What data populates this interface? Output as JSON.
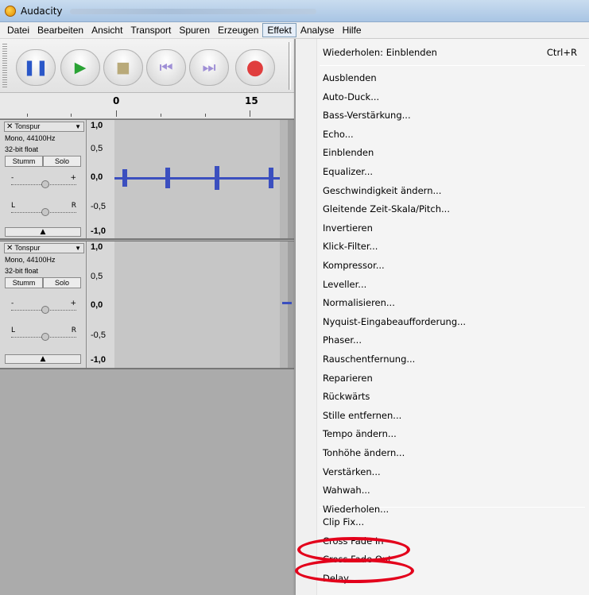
{
  "window": {
    "title": "Audacity"
  },
  "menubar": {
    "items": [
      "Datei",
      "Bearbeiten",
      "Ansicht",
      "Transport",
      "Spuren",
      "Erzeugen",
      "Effekt",
      "Analyse",
      "Hilfe"
    ],
    "active": "Effekt"
  },
  "transport": {
    "buttons": [
      {
        "name": "pause",
        "glyph": "❚❚",
        "color": "#2a57c8"
      },
      {
        "name": "play",
        "glyph": "▶",
        "color": "#2aa335"
      },
      {
        "name": "stop",
        "glyph": "■",
        "color": "#b9aa7a"
      },
      {
        "name": "skip-start",
        "glyph": "⏮",
        "color": "#9f8fd6"
      },
      {
        "name": "skip-end",
        "glyph": "⏭",
        "color": "#9f8fd6"
      },
      {
        "name": "record",
        "glyph": "●",
        "color": "#e03e3e"
      }
    ]
  },
  "ruler": {
    "labels": [
      "0",
      "15"
    ]
  },
  "tracks": [
    {
      "name": "Tonspur",
      "info1": "Mono, 44100Hz",
      "info2": "32-bit float",
      "mute": "Stumm",
      "solo": "Solo",
      "gain_minus": "-",
      "gain_plus": "+",
      "pan_left": "L",
      "pan_right": "R",
      "scale": [
        "1,0",
        "0,5",
        "0,0",
        "-0,5",
        "-1,0"
      ]
    },
    {
      "name": "Tonspur",
      "info1": "Mono, 44100Hz",
      "info2": "32-bit float",
      "mute": "Stumm",
      "solo": "Solo",
      "gain_minus": "-",
      "gain_plus": "+",
      "pan_left": "L",
      "pan_right": "R",
      "scale": [
        "1,0",
        "0,5",
        "0,0",
        "-0,5",
        "-1,0"
      ]
    }
  ],
  "effect_menu": {
    "repeat": {
      "label": "Wiederholen: Einblenden",
      "shortcut": "Ctrl+R"
    },
    "items": [
      "Ausblenden",
      "Auto-Duck...",
      "Bass-Verstärkung...",
      "Echo...",
      "Einblenden",
      "Equalizer...",
      "Geschwindigkeit ändern...",
      "Gleitende Zeit-Skala/Pitch...",
      "Invertieren",
      "Klick-Filter...",
      "Kompressor...",
      "Leveller...",
      "Normalisieren...",
      "Nyquist-Eingabeaufforderung...",
      "Phaser...",
      "Rauschentfernung...",
      "Reparieren",
      "Rückwärts",
      "Stille entfernen...",
      "Tempo ändern...",
      "Tonhöhe ändern...",
      "Verstärken...",
      "Wahwah...",
      "Wiederholen..."
    ],
    "plugins": [
      "Clip Fix...",
      "Cross Fade In",
      "Cross Fade Out",
      "Delay..."
    ],
    "highlight_color": "#e3001b"
  }
}
